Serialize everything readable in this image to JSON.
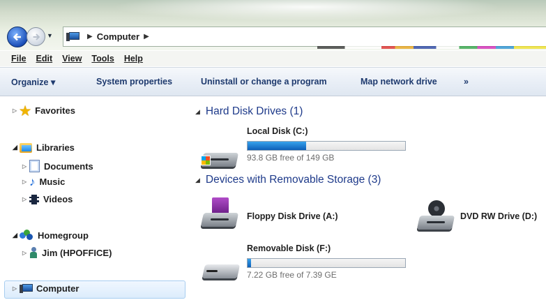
{
  "window": {
    "breadcrumb": [
      "Computer"
    ],
    "address_icon": "computer-icon",
    "nav": {
      "back_icon": "back-arrow-icon",
      "forward_icon": "forward-arrow-icon"
    }
  },
  "menu": [
    "File",
    "Edit",
    "View",
    "Tools",
    "Help"
  ],
  "commands": {
    "organize": "Organize ▾",
    "system_properties": "System properties",
    "uninstall": "Uninstall or change a program",
    "map_drive": "Map network drive",
    "more": "»"
  },
  "sidebar": {
    "favorites": "Favorites",
    "libraries": "Libraries",
    "documents": "Documents",
    "music": "Music",
    "videos": "Videos",
    "homegroup": "Homegroup",
    "user": "Jim (HPOFFICE)",
    "computer": "Computer"
  },
  "content": {
    "hdd_group": "Hard Disk Drives (1)",
    "removable_group": "Devices with Removable Storage (3)",
    "drives": {
      "local": {
        "name": "Local Disk (C:)",
        "free": "93.8 GB free of 149 GB",
        "used_fraction": 0.37
      },
      "floppy": {
        "name": "Floppy Disk Drive (A:)"
      },
      "dvd": {
        "name": "DVD RW Drive (D:)"
      },
      "removable": {
        "name": "Removable Disk (F:)",
        "free": "7.22 GB free of 7.39 GE",
        "used_fraction": 0.02
      }
    }
  },
  "colors": {
    "accent": "#1e3a8a",
    "bar_fill": "#0d5fb8",
    "selection": "#dcecfc"
  }
}
